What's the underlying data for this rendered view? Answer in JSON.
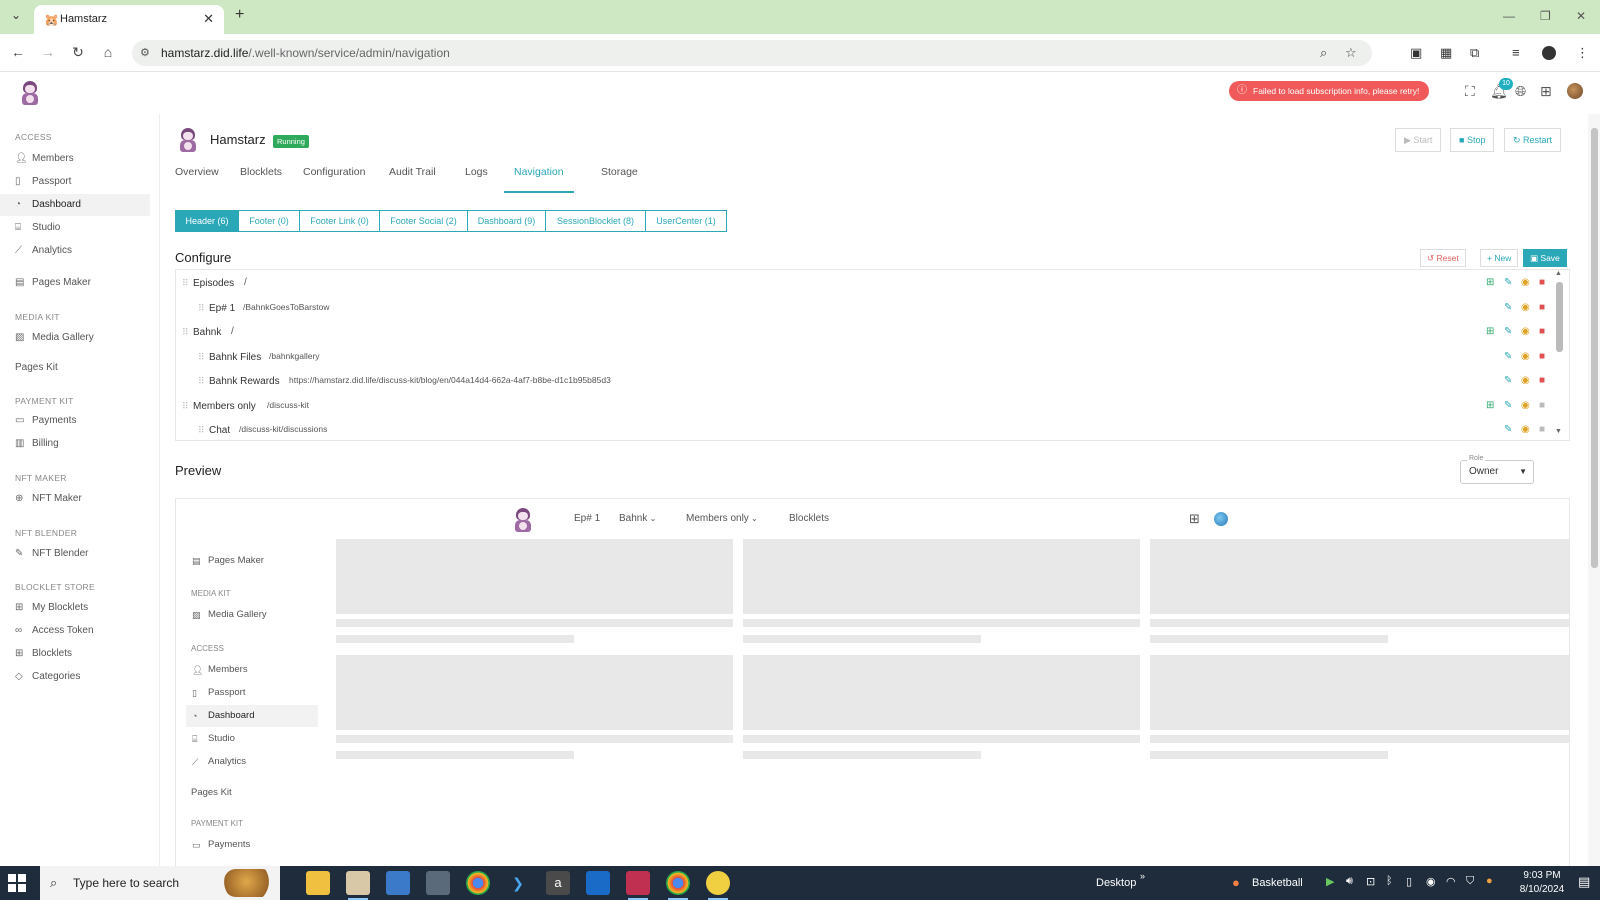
{
  "browser": {
    "tab_title": "Hamstarz",
    "url_host": "hamstarz.did.life",
    "url_path": "/.well-known/service/admin/navigation"
  },
  "header": {
    "error_message": "Failed to load subscription info, please retry!",
    "notification_count": "10"
  },
  "sidebar": {
    "sec_access": "ACCESS",
    "members": "Members",
    "passport": "Passport",
    "dashboard": "Dashboard",
    "studio": "Studio",
    "analytics": "Analytics",
    "pages_maker": "Pages Maker",
    "sec_media_kit": "MEDIA KIT",
    "media_gallery": "Media Gallery",
    "pages_kit": "Pages Kit",
    "sec_payment_kit": "PAYMENT KIT",
    "payments": "Payments",
    "billing": "Billing",
    "sec_nft_maker": "NFT MAKER",
    "nft_maker": "NFT Maker",
    "sec_nft_blender": "NFT BLENDER",
    "nft_blender": "NFT Blender",
    "sec_blocklet_store": "BLOCKLET STORE",
    "my_blocklets": "My Blocklets",
    "access_token": "Access Token",
    "blocklets": "Blocklets",
    "categories": "Categories"
  },
  "app": {
    "name": "Hamstarz",
    "status": "Running",
    "start": "Start",
    "stop": "Stop",
    "restart": "Restart"
  },
  "tabs": [
    "Overview",
    "Blocklets",
    "Configuration",
    "Audit Trail",
    "Logs",
    "Navigation",
    "Storage"
  ],
  "subtabs": [
    "Header (6)",
    "Footer (0)",
    "Footer Link (0)",
    "Footer Social (2)",
    "Dashboard (9)",
    "SessionBlocklet (8)",
    "UserCenter (1)"
  ],
  "configure": {
    "title": "Configure",
    "reset": "Reset",
    "new": "New",
    "save": "Save",
    "rows": [
      {
        "label": "Episodes",
        "path": "/"
      },
      {
        "label": "Ep# 1",
        "path": "/BahnkGoesToBarstow"
      },
      {
        "label": "Bahnk",
        "path": "/"
      },
      {
        "label": "Bahnk Files",
        "path": "/bahnkgallery"
      },
      {
        "label": "Bahnk Rewards",
        "path": "https://hamstarz.did.life/discuss-kit/blog/en/044a14d4-662a-4af7-b8be-d1c1b95b85d3"
      },
      {
        "label": "Members only",
        "path": "/discuss-kit"
      },
      {
        "label": "Chat",
        "path": "/discuss-kit/discussions"
      }
    ]
  },
  "preview": {
    "title": "Preview",
    "role_label": "Role",
    "role_value": "Owner",
    "nav_ep1": "Ep# 1",
    "nav_bahnk": "Bahnk",
    "nav_members": "Members only",
    "nav_blocklets": "Blocklets",
    "sb_pages_maker": "Pages Maker",
    "sb_sec_media_kit": "MEDIA KIT",
    "sb_media_gallery": "Media Gallery",
    "sb_sec_access": "ACCESS",
    "sb_members": "Members",
    "sb_passport": "Passport",
    "sb_dashboard": "Dashboard",
    "sb_studio": "Studio",
    "sb_analytics": "Analytics",
    "sb_pages_kit": "Pages Kit",
    "sb_sec_payment_kit": "PAYMENT KIT",
    "sb_payments": "Payments"
  },
  "taskbar": {
    "search_placeholder": "Type here to search",
    "desktop": "Desktop",
    "weather": "Basketball",
    "time": "9:03 PM",
    "date": "8/10/2024"
  },
  "colors": {
    "accent": "#2aa8b8",
    "running": "#2eaa5a",
    "error": "#f05a5a",
    "delete": "#e05050",
    "visibility": "#e0a020"
  }
}
